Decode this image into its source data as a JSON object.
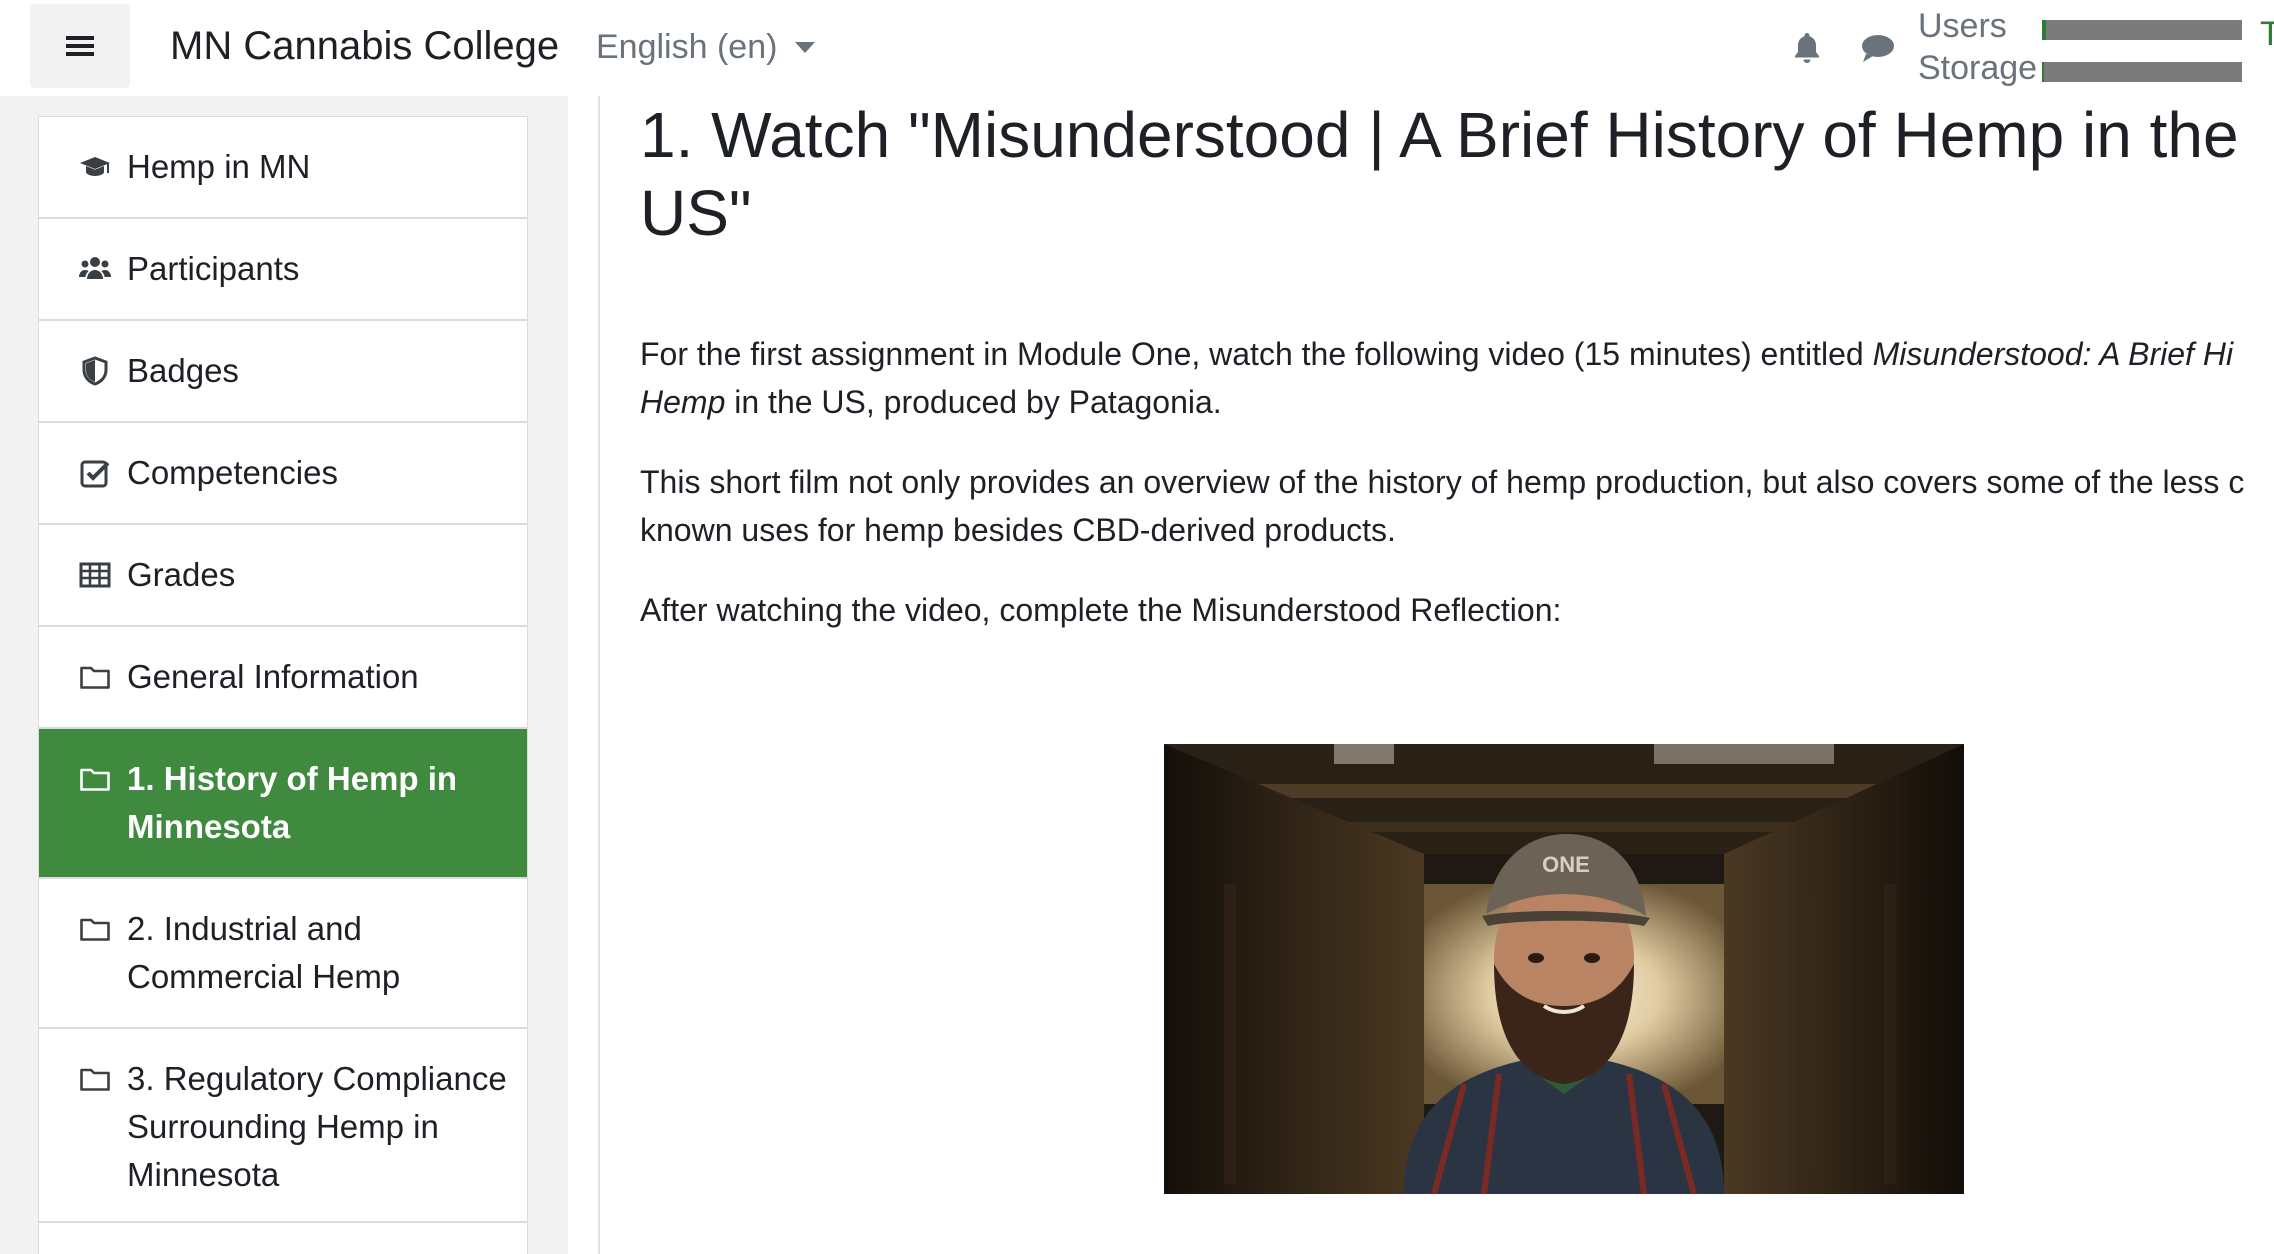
{
  "navbar": {
    "site_name": "MN Cannabis College",
    "language": "English ‎(en)‎",
    "quota": {
      "users_label": "Users",
      "storage_label": "Storage",
      "users_fraction": 0.02,
      "storage_fraction": 0.01,
      "edge_text": "T"
    },
    "icons": [
      "menu-icon",
      "bell-icon",
      "chat-icon"
    ]
  },
  "drawer": {
    "items": [
      {
        "label": "Hemp in MN",
        "icon": "graduation-cap-icon"
      },
      {
        "label": "Participants",
        "icon": "users-icon"
      },
      {
        "label": "Badges",
        "icon": "shield-icon"
      },
      {
        "label": "Competencies",
        "icon": "check-square-icon"
      },
      {
        "label": "Grades",
        "icon": "table-icon"
      },
      {
        "label": "General Information",
        "icon": "folder-icon"
      },
      {
        "label": "1. History of Hemp in Minnesota",
        "icon": "folder-icon",
        "active": true
      },
      {
        "label": "2. Industrial and Commercial Hemp",
        "icon": "folder-icon"
      },
      {
        "label": "3. Regulatory Compliance Surrounding Hemp in Minnesota",
        "icon": "folder-icon"
      }
    ]
  },
  "main": {
    "title": "1. Watch \"Misunderstood | A Brief History of Hemp in the US\"",
    "p1_a": "For the first assignment in Module One, watch the following video (15 minutes) entitled ",
    "p1_em1": "Misunderstood: A Brief Hi",
    "p1_em2": "Hemp",
    "p1_b": " in the US, produced by Patagonia.",
    "p2": "This short film not only provides an overview of the history of hemp production, but also covers some of the less c known uses for hemp besides CBD-derived products.",
    "p3": "After watching the video, complete the Misunderstood Reflection:"
  },
  "colors": {
    "brand_green": "#3f8a3f",
    "drawer_bg": "#f2f2f2",
    "text": "#1d2125",
    "muted": "#6a737b"
  }
}
